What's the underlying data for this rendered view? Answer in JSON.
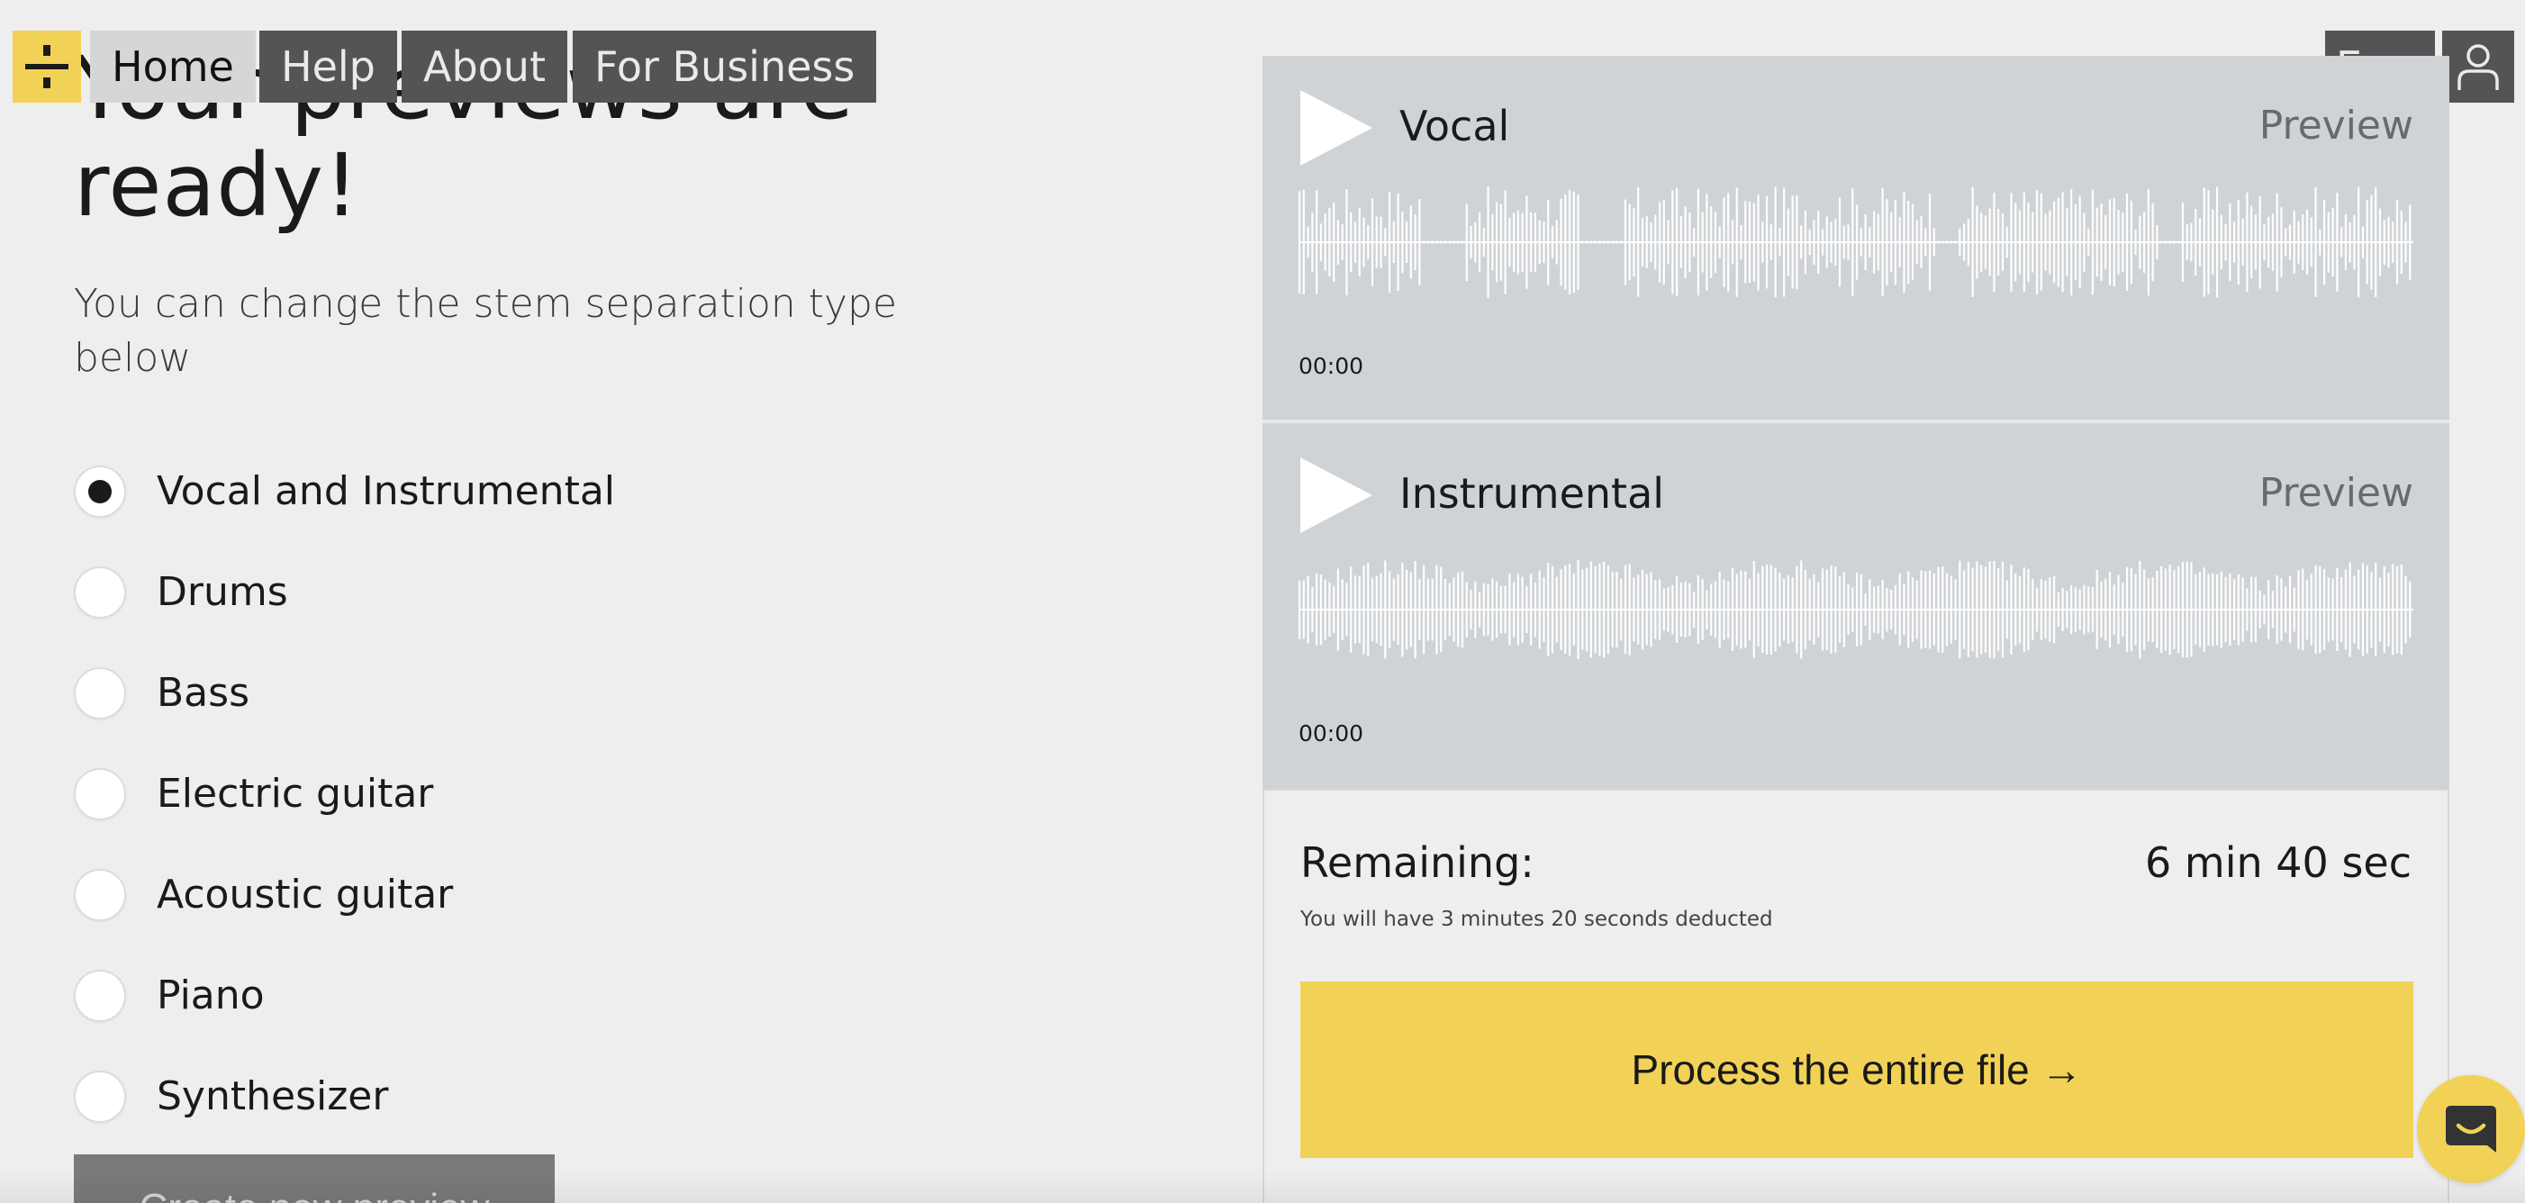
{
  "nav": {
    "logo_icon": "divide-icon",
    "items": [
      {
        "label": "Home",
        "active": true
      },
      {
        "label": "Help",
        "active": false
      },
      {
        "label": "About",
        "active": false
      },
      {
        "label": "For Business",
        "active": false
      }
    ],
    "language": "En",
    "language_icon": "chevron-down-icon",
    "user_icon": "user-icon"
  },
  "main": {
    "heading": "Your previews are ready!",
    "subtitle": "You can change the stem separation type below",
    "options": [
      {
        "label": "Vocal and Instrumental",
        "selected": true
      },
      {
        "label": "Drums",
        "selected": false
      },
      {
        "label": "Bass",
        "selected": false
      },
      {
        "label": "Electric guitar",
        "selected": false
      },
      {
        "label": "Acoustic guitar",
        "selected": false
      },
      {
        "label": "Piano",
        "selected": false
      },
      {
        "label": "Synthesizer",
        "selected": false
      }
    ],
    "create_button": "Create new preview"
  },
  "tracks": [
    {
      "name": "Vocal",
      "preview_label": "Preview",
      "time": "00:00",
      "play_icon": "play-icon"
    },
    {
      "name": "Instrumental",
      "preview_label": "Preview",
      "time": "00:00",
      "play_icon": "play-icon"
    }
  ],
  "summary": {
    "remaining_label": "Remaining:",
    "remaining_value": "6 min 40 sec",
    "deduct_note": "You will have 3 minutes 20 seconds deducted",
    "process_button": "Process the entire file →"
  },
  "chat_icon": "chat-icon",
  "colors": {
    "accent": "#f2d256",
    "nav_bg": "#545454",
    "track_bg": "#d0d3d6",
    "page_bg": "#eeeeee"
  }
}
